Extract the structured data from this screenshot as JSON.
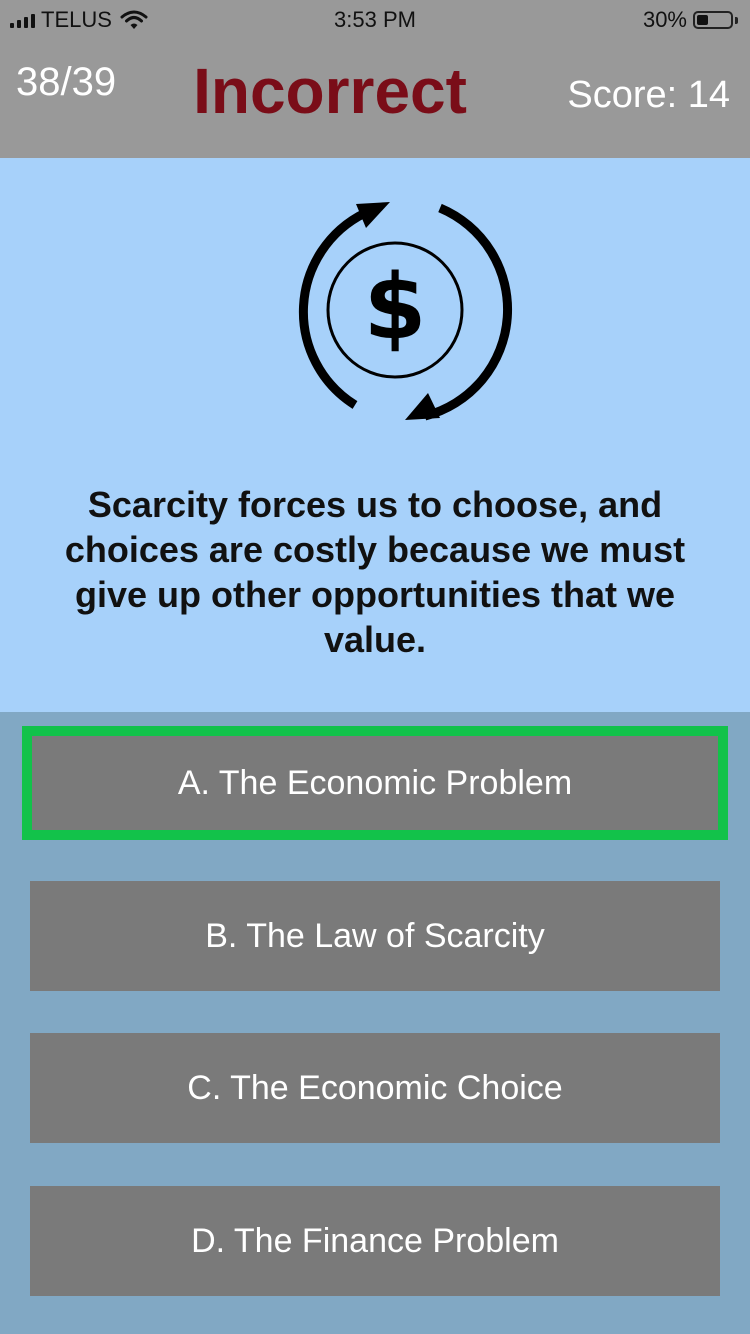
{
  "status": {
    "carrier": "TELUS",
    "time": "3:53 PM",
    "battery": "30%",
    "battery_level": 0.3
  },
  "header": {
    "progress": "38/39",
    "result": "Incorrect",
    "score": "Score: 14",
    "result_color": "#7a0d18"
  },
  "question": {
    "icon": "dollar-cycle-icon",
    "text": "Scarcity forces us to choose, and choices are costly because we must give up other opportunities that we value."
  },
  "answers": [
    {
      "label": "A. The Economic Problem",
      "correct": true
    },
    {
      "label": "B. The Law of Scarcity",
      "correct": false
    },
    {
      "label": "C. The Economic Choice",
      "correct": false
    },
    {
      "label": "D. The Finance Problem",
      "correct": false
    }
  ],
  "colors": {
    "header_bg": "#999999",
    "question_bg": "#a7d1fa",
    "answers_bg": "#81a8c4",
    "answer_bg": "#7a7a7a",
    "correct_border": "#12c24a"
  }
}
